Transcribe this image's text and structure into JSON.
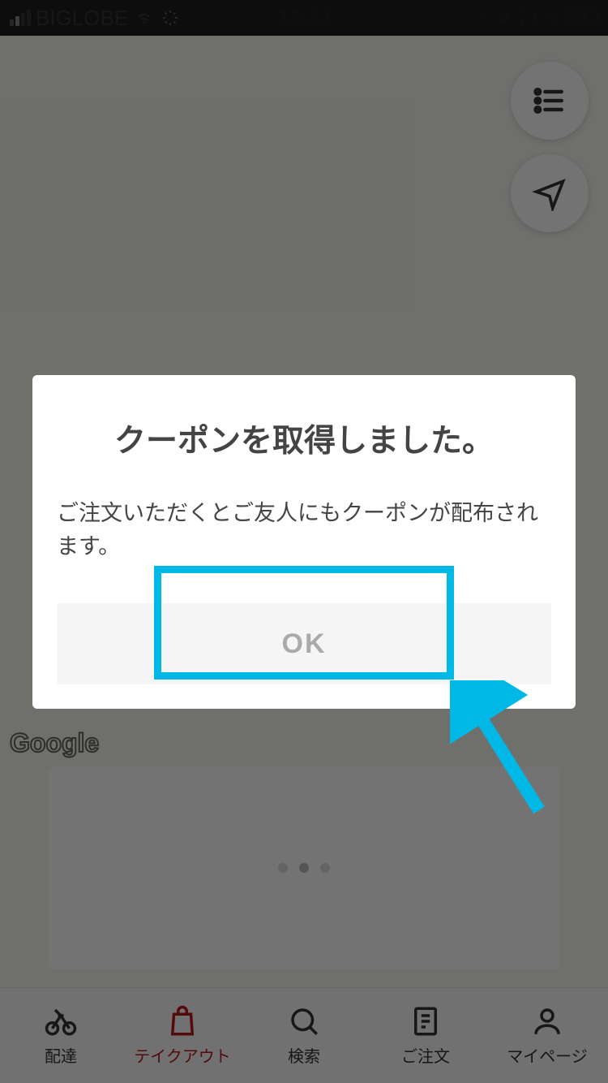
{
  "status_bar": {
    "carrier": "BIGLOBE",
    "time": "18:42",
    "battery_percent": "71%"
  },
  "floating_buttons": {
    "list": "list-view",
    "location": "my-location"
  },
  "map": {
    "attribution": "Google"
  },
  "modal": {
    "title": "クーポンを取得しました。",
    "body": "ご注文いただくとご友人にもクーポンが配布されます。",
    "ok_label": "OK"
  },
  "tab_bar": {
    "items": [
      {
        "label": "配達",
        "icon": "bicycle-icon"
      },
      {
        "label": "テイクアウト",
        "icon": "shopping-bag-icon"
      },
      {
        "label": "検索",
        "icon": "search-icon"
      },
      {
        "label": "ご注文",
        "icon": "receipt-icon"
      },
      {
        "label": "マイページ",
        "icon": "person-icon"
      }
    ],
    "active_index": 1
  },
  "colors": {
    "highlight": "#00b8e6",
    "active_tab": "#b91919"
  }
}
